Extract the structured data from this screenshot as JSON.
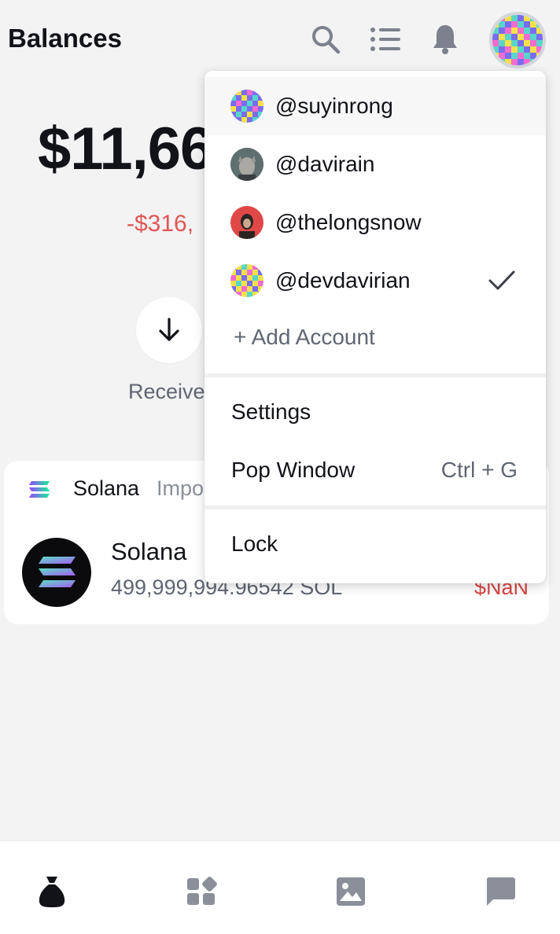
{
  "header": {
    "title": "Balances",
    "icons": [
      "search-icon",
      "list-icon",
      "bell-icon",
      "avatar"
    ]
  },
  "balance": {
    "amount_visible": "$11,66",
    "amount_right_fragment": ".",
    "change_visible": "-$316,"
  },
  "actions": {
    "receive_label": "Receive"
  },
  "token_card": {
    "network": "Solana",
    "network_extra": "Impo",
    "token_name": "Solana",
    "token_amount": "499,999,994.96542 SOL",
    "token_value": "$NaN"
  },
  "account_menu": {
    "accounts": [
      {
        "handle": "@suyinrong",
        "selected": false
      },
      {
        "handle": "@davirain",
        "selected": false
      },
      {
        "handle": "@thelongsnow",
        "selected": false
      },
      {
        "handle": "@devdavirian",
        "selected": true
      }
    ],
    "add_account": "+ Add Account",
    "settings": "Settings",
    "pop_window": "Pop Window",
    "pop_window_shortcut": "Ctrl + G",
    "lock": "Lock"
  },
  "bottom_nav": {
    "tabs": [
      "balances-tab",
      "apps-tab",
      "collectibles-tab",
      "messages-tab"
    ]
  },
  "colors": {
    "background": "#f3f3f4",
    "negative": "#e05656",
    "text_primary": "#111318",
    "text_secondary": "#5f6573"
  }
}
